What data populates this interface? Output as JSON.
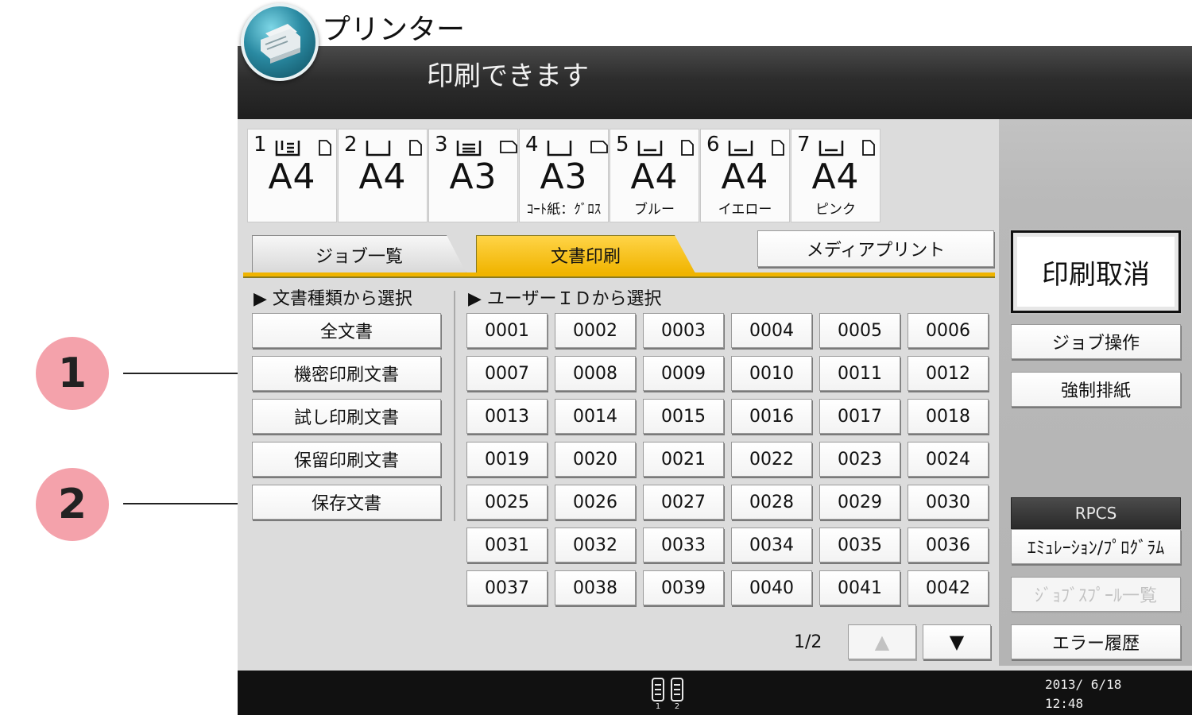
{
  "app": {
    "title": "プリンター"
  },
  "status": {
    "message": "印刷できます"
  },
  "trays": [
    {
      "num": "1",
      "size": "A4",
      "type": ""
    },
    {
      "num": "2",
      "size": "A4",
      "type": ""
    },
    {
      "num": "3",
      "size": "A3",
      "type": ""
    },
    {
      "num": "4",
      "size": "A3",
      "type": "ｺｰﾄ紙：ｸﾞﾛｽ"
    },
    {
      "num": "5",
      "size": "A4",
      "type": "ブルー"
    },
    {
      "num": "6",
      "size": "A4",
      "type": "イエロー"
    },
    {
      "num": "7",
      "size": "A4",
      "type": "ピンク"
    }
  ],
  "tabs": {
    "job_list": "ジョブ一覧",
    "doc_print": "文書印刷"
  },
  "media_print": "メディアプリント",
  "doc_section": {
    "label": "▶ 文書種類から選択",
    "items": [
      "全文書",
      "機密印刷文書",
      "試し印刷文書",
      "保留印刷文書",
      "保存文書"
    ]
  },
  "user_section": {
    "label": "▶ ユーザーＩＤから選択",
    "ids": [
      "0001",
      "0002",
      "0003",
      "0004",
      "0005",
      "0006",
      "0007",
      "0008",
      "0009",
      "0010",
      "0011",
      "0012",
      "0013",
      "0014",
      "0015",
      "0016",
      "0017",
      "0018",
      "0019",
      "0020",
      "0021",
      "0022",
      "0023",
      "0024",
      "0025",
      "0026",
      "0027",
      "0028",
      "0029",
      "0030",
      "0031",
      "0032",
      "0033",
      "0034",
      "0035",
      "0036",
      "0037",
      "0038",
      "0039",
      "0040",
      "0041",
      "0042"
    ]
  },
  "pager": {
    "indicator": "1/2",
    "up": "▲",
    "down": "▼"
  },
  "side": {
    "cancel": "印刷取消",
    "job_ops": "ジョブ操作",
    "force_eject": "強制排紙",
    "emulation_header": "RPCS",
    "emulation_btn": "ｴﾐｭﾚｰｼｮﾝ/ﾌﾟﾛｸﾞﾗﾑ",
    "spool_list": "ｼﾞｮﾌﾞｽﾌﾟｰﾙ一覧",
    "error_history": "エラー履歴"
  },
  "bottom": {
    "date": "2013/ 6/18",
    "time": "12:48",
    "toner_labels": [
      "1",
      "2"
    ]
  },
  "callouts": [
    "1",
    "2"
  ]
}
